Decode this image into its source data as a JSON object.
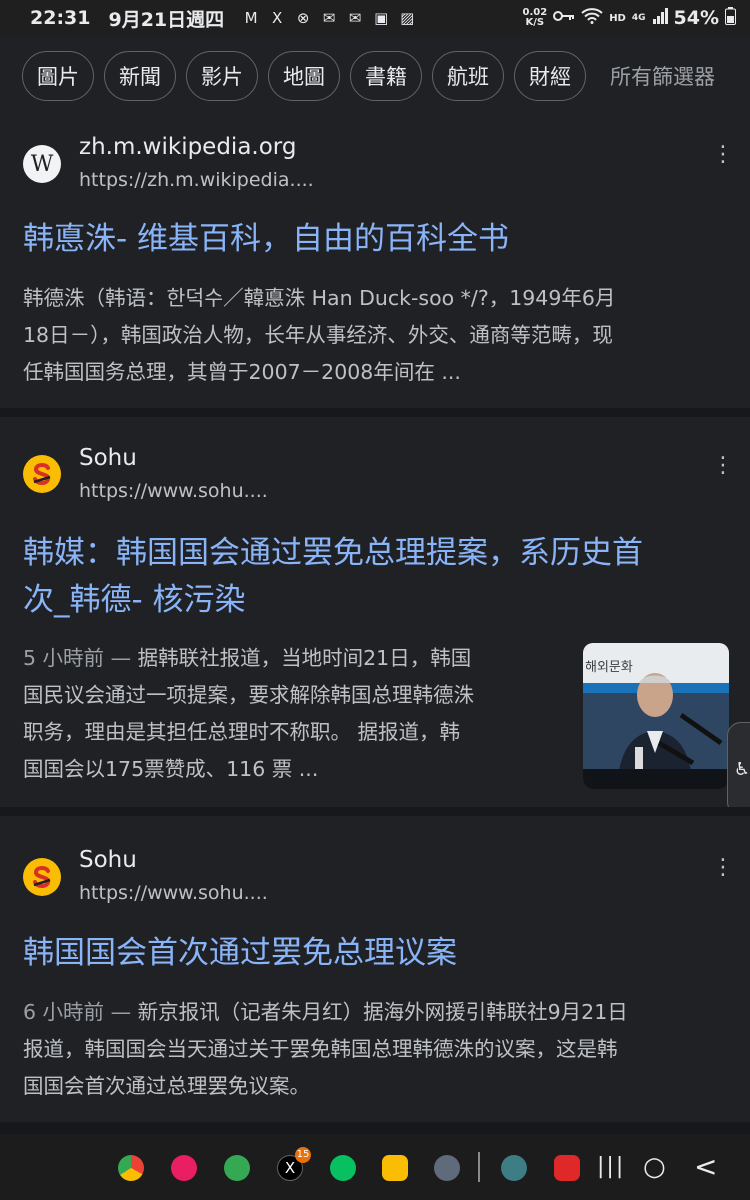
{
  "status_bar": {
    "time": "22:31",
    "date": "9月21日週四",
    "notification_icons": [
      "M",
      "X",
      "⊗",
      "✉",
      "✉",
      "▣",
      "▨"
    ],
    "net_speed_value": "0.02",
    "net_speed_unit": "K/S",
    "network_type": "HD",
    "signal": "4G",
    "battery": "54%"
  },
  "filters": {
    "chips": [
      "圖片",
      "新聞",
      "影片",
      "地圖",
      "書籍",
      "航班",
      "財經"
    ],
    "all_filters": "所有篩選器"
  },
  "results": [
    {
      "site_name": "zh.m.wikipedia.org",
      "url": "https://zh.m.wikipedia....",
      "favicon": "W",
      "title": "韩悳洙- 维基百科，自由的百科全书",
      "snippet_lines": [
        "韩德洙（韩语：한덕수／韓悳洙 Han Duck-soo */?，1949年6月",
        "18日－），韩国政治人物，长年从事经济、外交、通商等范畴，现",
        "任韩国国务总理，其曾于2007－2008年间在 ..."
      ]
    },
    {
      "site_name": "Sohu",
      "url": "https://www.sohu....",
      "favicon": "S",
      "title_lines": [
        "韩媒：韩国国会通过罢免总理提案，系历史首",
        "次_韩德- 核污染"
      ],
      "age": "5 小時前 —",
      "snippet_lines": [
        "据韩联社报道，当地时间21日，韩国",
        "国民议会通过一项提案，要求解除韩国总理韩德洙",
        "职务，理由是其担任总理时不称职。 据报道，韩",
        "国国会以175票赞成、116 票 ..."
      ],
      "thumbnail_text": "해외문화"
    },
    {
      "site_name": "Sohu",
      "url": "https://www.sohu....",
      "favicon": "S",
      "title": "韩国国会首次通过罢免总理议案",
      "age": "6 小時前 —",
      "snippet_lines": [
        "新京报讯（记者朱月红）据海外网援引韩联社9月21日",
        "报道，韩国国会当天通过关于罢免韩国总理韩德洙的议案，这是韩",
        "国国会首次通过总理罢免议案。"
      ]
    }
  ],
  "more_icon": "⋮",
  "accessibility_icon": "♿",
  "nav": {
    "x_badge": "15",
    "recents": "|||",
    "home": "○",
    "back": "<"
  },
  "dock_apps": [
    {
      "name": "chrome",
      "color": "#e8eaed"
    },
    {
      "name": "flower",
      "color": "#e91e63"
    },
    {
      "name": "feather",
      "color": "#34a853"
    },
    {
      "name": "x",
      "color": "#000000"
    },
    {
      "name": "wechat",
      "color": "#07c160"
    },
    {
      "name": "folder",
      "color": "#fbbc04"
    },
    {
      "name": "apps",
      "color": "#5f6b7a"
    },
    {
      "name": "orb",
      "color": "#3d7d84"
    },
    {
      "name": "flipboard",
      "color": "#e12828"
    }
  ]
}
